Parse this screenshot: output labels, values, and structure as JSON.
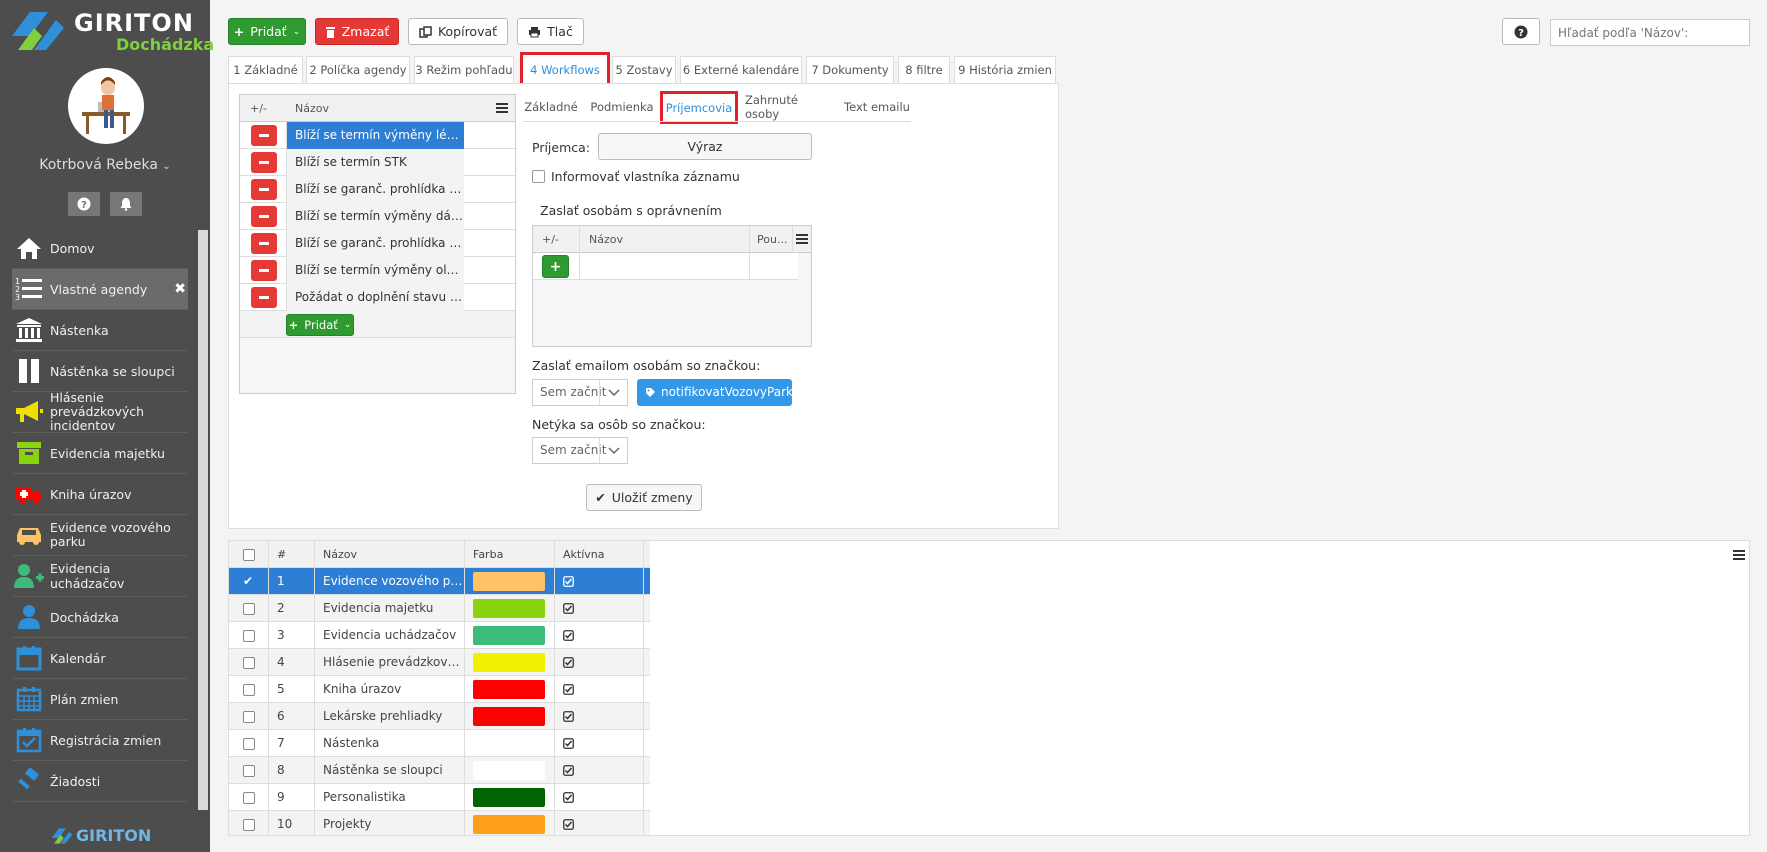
{
  "app": {
    "brand": "GIRITON",
    "product": "Dochádzka",
    "footer_brand": "GIRITON"
  },
  "user": {
    "name": "Kotrbová Rebeka"
  },
  "sidebar": {
    "items": [
      {
        "label": "Domov",
        "icon": "home-icon"
      },
      {
        "label": "Vlastné agendy",
        "icon": "numbered-list-icon",
        "active": true
      },
      {
        "label": "Nástenka",
        "icon": "bank-icon"
      },
      {
        "label": "Nástěnka se sloupci",
        "icon": "columns-icon"
      },
      {
        "label": "Hlásenie prevádzkových incidentov",
        "icon": "megaphone-icon"
      },
      {
        "label": "Evidencia majetku",
        "icon": "box-icon"
      },
      {
        "label": "Kniha úrazov",
        "icon": "ambulance-icon"
      },
      {
        "label": "Evidence vozového parku",
        "icon": "car-icon"
      },
      {
        "label": "Evidencia uchádzačov",
        "icon": "user-plus-icon"
      },
      {
        "label": "Dochádzka",
        "icon": "user-icon"
      },
      {
        "label": "Kalendár",
        "icon": "calendar-icon"
      },
      {
        "label": "Plán zmien",
        "icon": "calendar-grid-icon"
      },
      {
        "label": "Registrácia zmien",
        "icon": "calendar-check-icon"
      },
      {
        "label": "Žiadosti",
        "icon": "gavel-icon"
      }
    ]
  },
  "toolbar": {
    "add": "Pridať",
    "delete": "Zmazať",
    "copy": "Kopírovať",
    "print": "Tlač",
    "help": "?"
  },
  "search": {
    "placeholder": "Hľadať podľa 'Názov':"
  },
  "tabs": [
    {
      "label": "1 Základné"
    },
    {
      "label": "2 Políčka agendy"
    },
    {
      "label": "3 Režim pohľadu"
    },
    {
      "label": "4 Workflows",
      "active": true
    },
    {
      "label": "5 Zostavy"
    },
    {
      "label": "6 Externé kalendáre"
    },
    {
      "label": "7 Dokumenty"
    },
    {
      "label": "8 filtre"
    },
    {
      "label": "9 História zmien"
    }
  ],
  "workflows": {
    "col_pm": "+/-",
    "col_name": "Názov",
    "add": "Pridať",
    "items": [
      "Blíží se termín výměny lékárničky",
      "Blíží se termín STK",
      "Blíží se garanč. prohlídka vozidla",
      "Blíží se termín výměny dálniční známky",
      "Blíží se garanč. prohlídka vozidla",
      "Blíží se termín výměny oleje",
      "Požádat o doplnění stavu tachometru"
    ]
  },
  "subtabs": [
    {
      "label": "Základné"
    },
    {
      "label": "Podmienka"
    },
    {
      "label": "Príjemcovia",
      "active": true
    },
    {
      "label": "Zahrnuté osoby"
    },
    {
      "label": "Text emailu"
    }
  ],
  "recipients": {
    "recipient_label": "Príjemca:",
    "expression_button": "Výraz",
    "inform_owner": "Informovať vlastníka záznamu",
    "send_perm_label": "Zaslať osobám s oprávnením",
    "perm_cols": {
      "pm": "+/-",
      "name": "Názov",
      "use": "Pou..."
    },
    "send_tag_label": "Zaslať emailom osobám so značkou:",
    "select_placeholder": "Sem začnit",
    "tag": "notifikovatVozovyPark",
    "excl_label": "Netýka sa osôb so značkou:",
    "save": "Uložiť zmeny"
  },
  "table": {
    "cols": {
      "num": "#",
      "name": "Názov",
      "color": "Farba",
      "active": "Aktívna"
    },
    "rows": [
      {
        "n": "1",
        "name": "Evidence vozového parku",
        "color": "#ffc266",
        "sel": true
      },
      {
        "n": "2",
        "name": "Evidencia majetku",
        "color": "#8ad30f"
      },
      {
        "n": "3",
        "name": "Evidencia uchádzačov",
        "color": "#3dbb7a"
      },
      {
        "n": "4",
        "name": "Hlásenie prevádzkových incidentov",
        "color": "#f0f000"
      },
      {
        "n": "5",
        "name": "Kniha úrazov",
        "color": "#ff0000"
      },
      {
        "n": "6",
        "name": "Lekárske prehliadky",
        "color": "#ff0000"
      },
      {
        "n": "7",
        "name": "Nástenka",
        "color": ""
      },
      {
        "n": "8",
        "name": "Nástěnka se sloupci",
        "color": "#ffffff"
      },
      {
        "n": "9",
        "name": "Personalistika",
        "color": "#006400"
      },
      {
        "n": "10",
        "name": "Projekty",
        "color": "#ff9f1c"
      }
    ]
  }
}
